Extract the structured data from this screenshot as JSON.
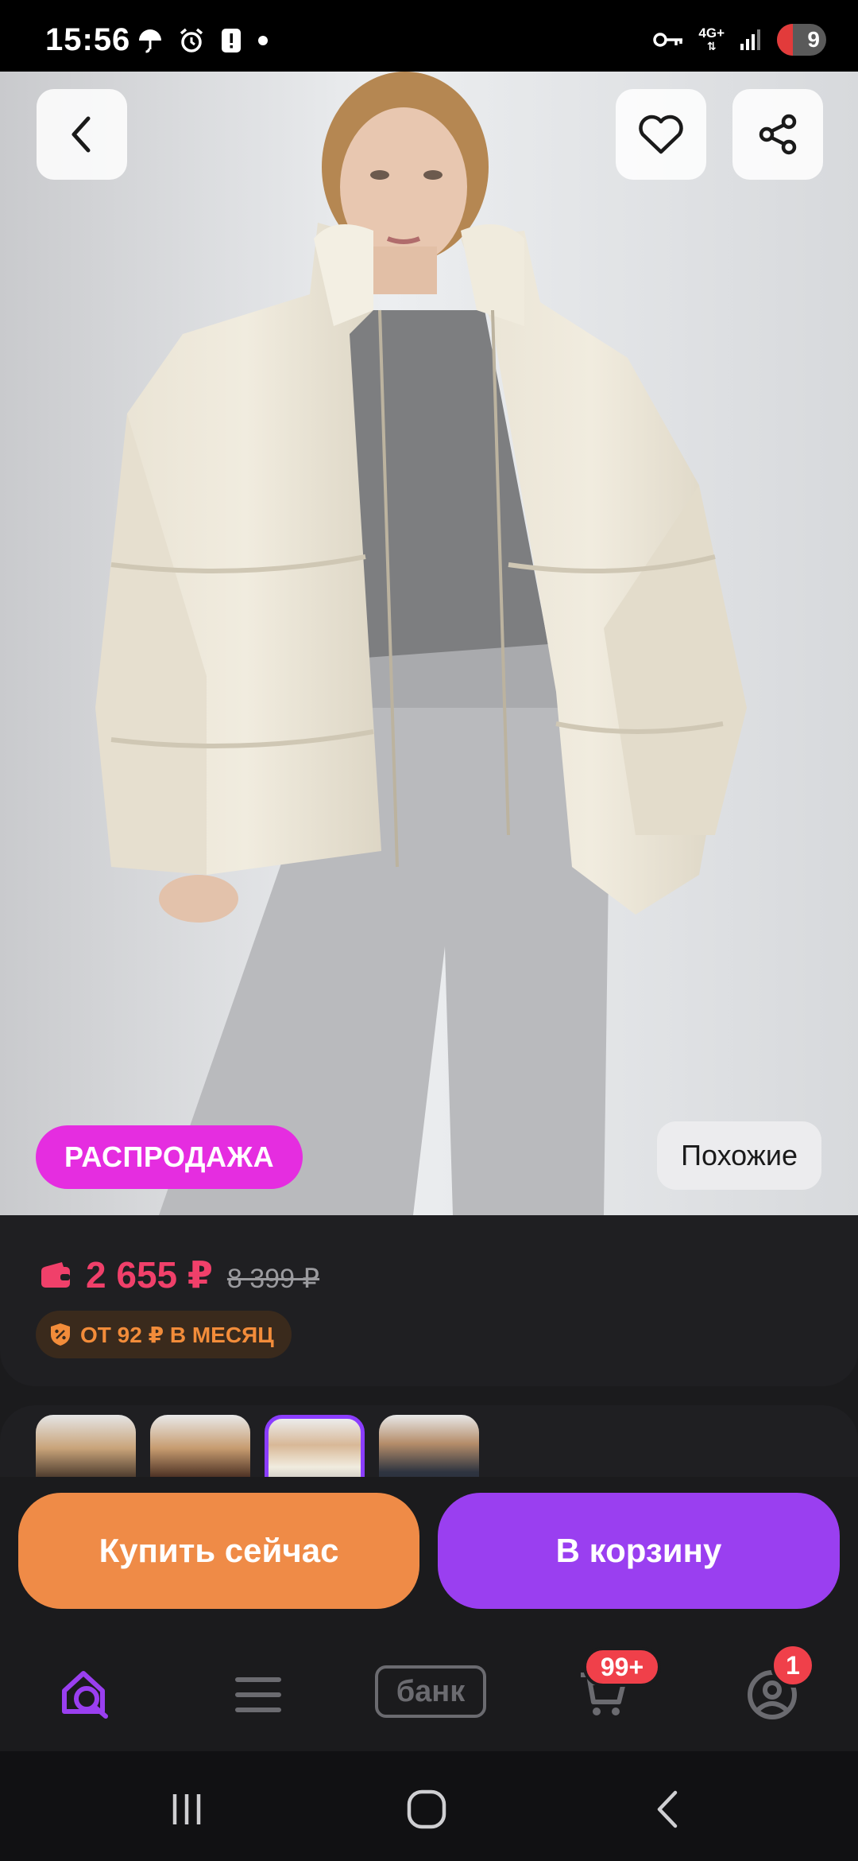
{
  "status_bar": {
    "time": "15:56",
    "network": "4G+",
    "battery": "9",
    "icons": [
      "umbrella-icon",
      "alarm-icon",
      "alert-icon",
      "dot-icon",
      "key-icon",
      "signal-icon",
      "battery-icon"
    ]
  },
  "header": {
    "back_icon": "chevron-left-icon",
    "favorite_icon": "heart-icon",
    "share_icon": "share-icon"
  },
  "hero": {
    "sale_label": "РАСПРОДАЖА",
    "similar_label": "Похожие"
  },
  "price": {
    "current": "2 655 ₽",
    "old": "8 399 ₽",
    "installment": "ОТ 92 ₽ В МЕСЯЦ",
    "wallet_icon": "wallet-icon",
    "installment_icon": "percent-shield-icon"
  },
  "thumbnails": {
    "count": 4,
    "active_index": 2
  },
  "actions": {
    "buy_now": "Купить сейчас",
    "add_to_cart": "В корзину"
  },
  "bottom_nav": {
    "items": [
      {
        "icon": "home-search-icon",
        "active": true
      },
      {
        "icon": "menu-icon",
        "active": false
      },
      {
        "label": "банк",
        "active": false
      },
      {
        "icon": "cart-icon",
        "badge": "99+",
        "active": false
      },
      {
        "icon": "profile-icon",
        "badge": "1",
        "active": false
      }
    ]
  },
  "colors": {
    "accent_purple": "#9a3ff0",
    "accent_orange": "#ef8b47",
    "sale_pink": "#e52de0",
    "price_red": "#f0406a",
    "background": "#1b1b1d"
  }
}
